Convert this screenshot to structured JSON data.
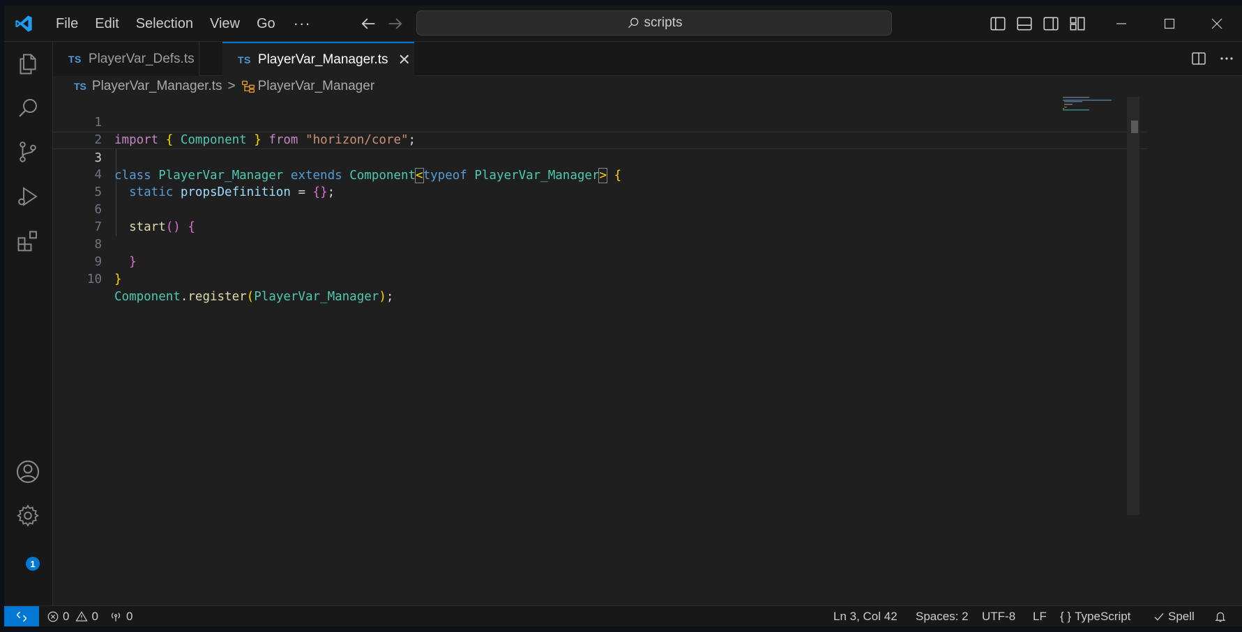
{
  "titlebar": {
    "menu": [
      "File",
      "Edit",
      "Selection",
      "View",
      "Go"
    ],
    "more": "···",
    "search_text": "scripts"
  },
  "tabs": [
    {
      "lang": "TS",
      "label": "PlayerVar_Defs.ts",
      "active": false
    },
    {
      "lang": "TS",
      "label": "PlayerVar_Manager.ts",
      "active": true,
      "close": "✕"
    }
  ],
  "breadcrumb": {
    "lang": "TS",
    "file": "PlayerVar_Manager.ts",
    "separator": ">",
    "symbol": "PlayerVar_Manager"
  },
  "editor": {
    "line_numbers": [
      "1",
      "2",
      "3",
      "4",
      "5",
      "6",
      "7",
      "8",
      "9",
      "10"
    ],
    "current_line": "3",
    "lines": [
      "import { Component } from \"horizon/core\";",
      "",
      "class PlayerVar_Manager extends Component<typeof PlayerVar_Manager> {",
      "  static propsDefinition = {};",
      "",
      "  start() {",
      "",
      "  }",
      "}",
      "Component.register(PlayerVar_Manager);"
    ]
  },
  "activity_bar": {
    "icons": [
      "files-icon",
      "search-icon",
      "source-control-icon",
      "run-debug-icon",
      "extensions-icon",
      "account-icon",
      "settings-gear-icon"
    ],
    "settings_badge": "1"
  },
  "statusbar": {
    "errors": "0",
    "warnings": "0",
    "ports": "0",
    "position": "Ln 3, Col 42",
    "spaces": "Spaces: 2",
    "encoding": "UTF-8",
    "eol": "LF",
    "language": "TypeScript",
    "language_braces": "{ }",
    "spell": "Spell"
  },
  "colors": {
    "accent": "#0078d4",
    "keyword": "#569cd6",
    "control_keyword": "#c586c0",
    "type": "#4ec9b0",
    "string": "#ce9178",
    "function": "#dcdcaa",
    "variable": "#9cdcfe"
  }
}
